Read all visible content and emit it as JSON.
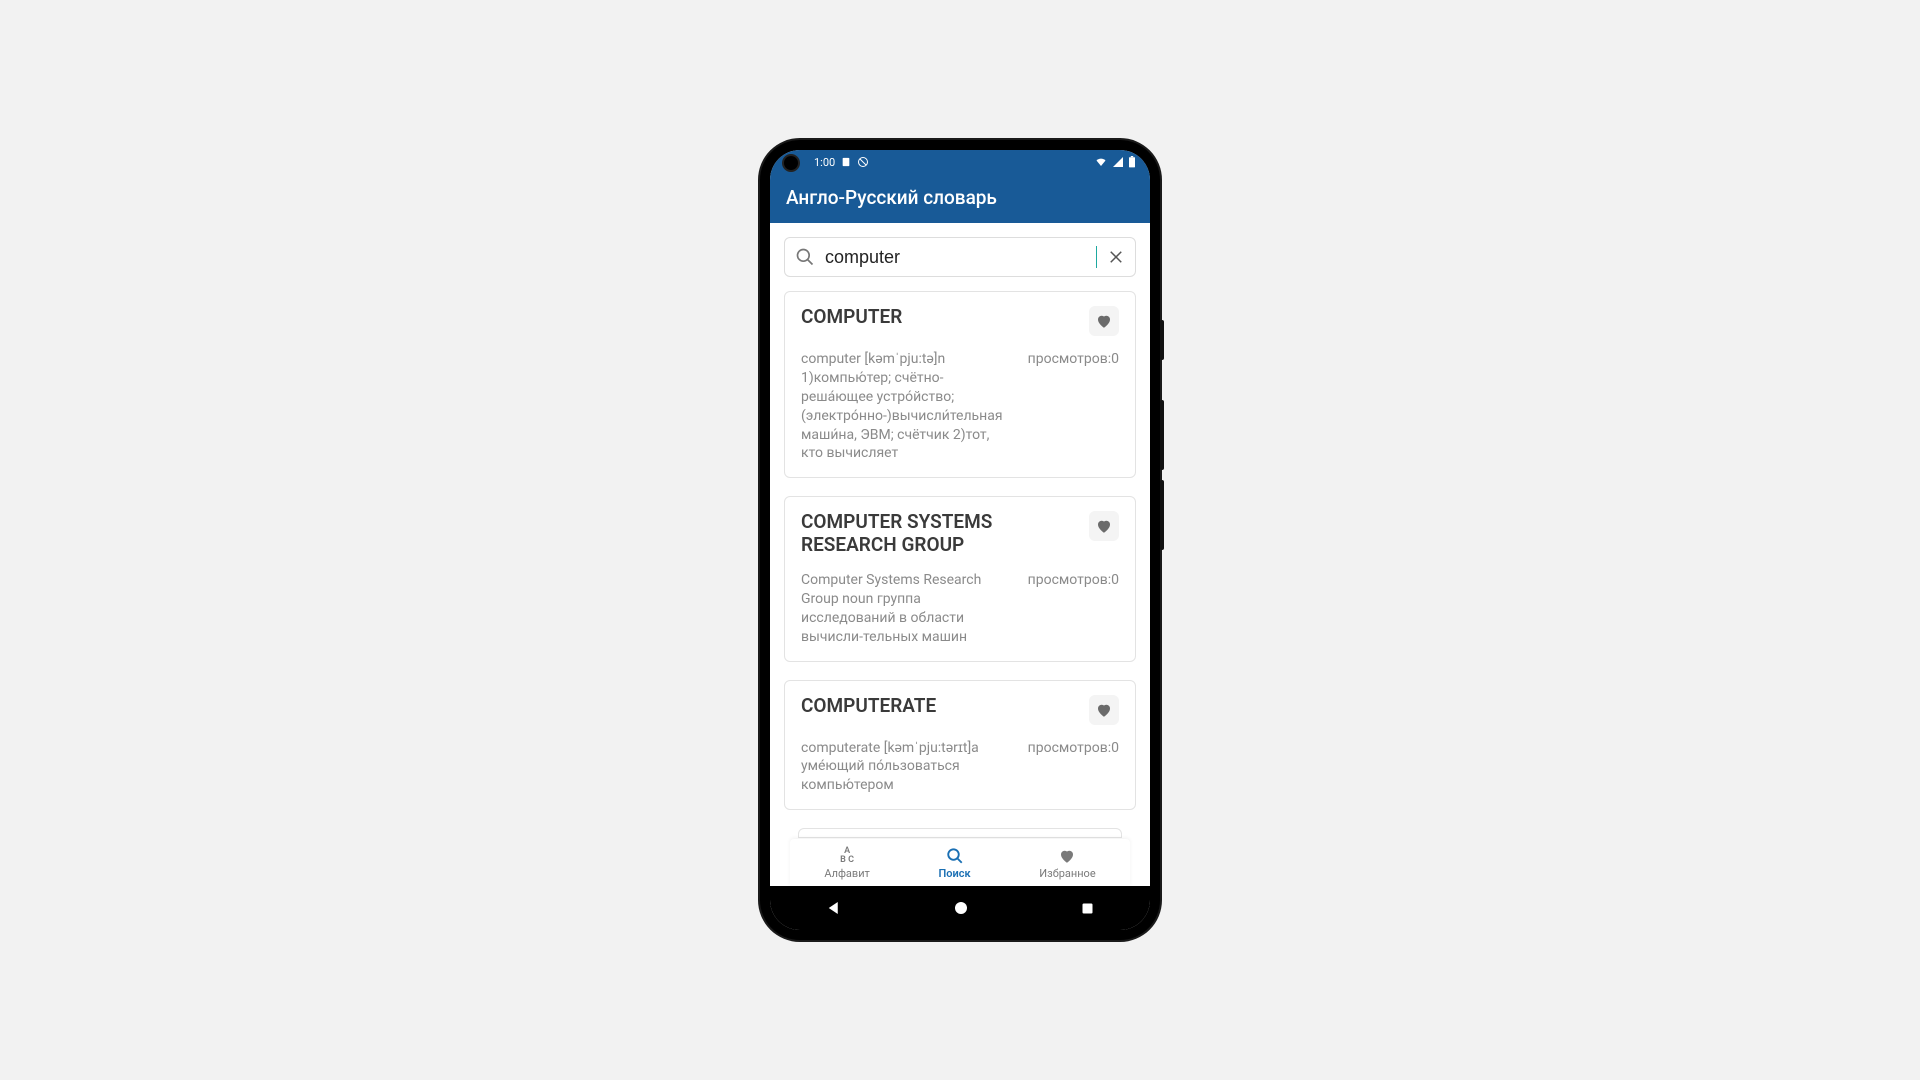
{
  "status_bar": {
    "time": "1:00"
  },
  "app": {
    "title": "Англо-Русский словарь"
  },
  "search": {
    "value": "computer",
    "placeholder": ""
  },
  "results": [
    {
      "title": "COMPUTER",
      "definition": "computer [kəmˈpju:tə]n 1)компью́тер; счётно-реша́ющее устро́йство; (электро́нно-)вычисли́тельная маши́на, ЭВМ; счётчик 2)тот, кто вычисляет",
      "views_label": "просмотров:0"
    },
    {
      "title": "COMPUTER SYSTEMS RESEARCH GROUP",
      "definition": "Computer Systems Research Group noun группа исследований в области вычисли-тельных машин",
      "views_label": "просмотров:0"
    },
    {
      "title": "COMPUTERATE",
      "definition": "computerate [kəmˈpju:tərɪt]a уме́ющий по́льзоваться компью́тером",
      "views_label": "просмотров:0"
    }
  ],
  "bottom_nav": {
    "alphabet": "Алфавит",
    "search": "Поиск",
    "favorites": "Избранное"
  }
}
